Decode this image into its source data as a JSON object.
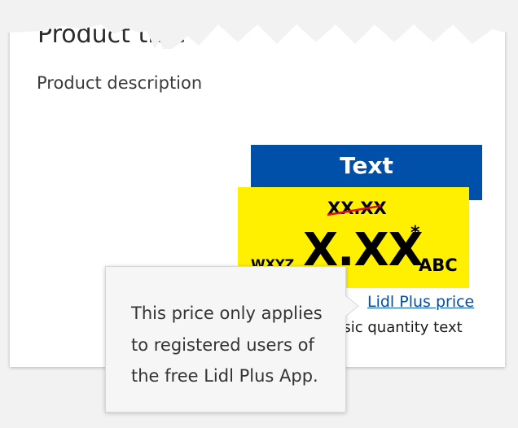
{
  "product": {
    "title": "Product title",
    "description": "Product description"
  },
  "ribbon": {
    "text": "Text",
    "color": "#0050aa"
  },
  "price": {
    "old_price": "XX.XX",
    "prefix": "WXYZ",
    "main": "X.XX",
    "asterisk": "*",
    "suffix": "ABC",
    "background": "#fff000"
  },
  "lidl_plus_link": "Lidl Plus price",
  "basic_quantity_text": "Basic quantity text",
  "tooltip": {
    "lines": [
      "This price only applies",
      "to registered users of",
      "the free Lidl Plus App."
    ]
  }
}
